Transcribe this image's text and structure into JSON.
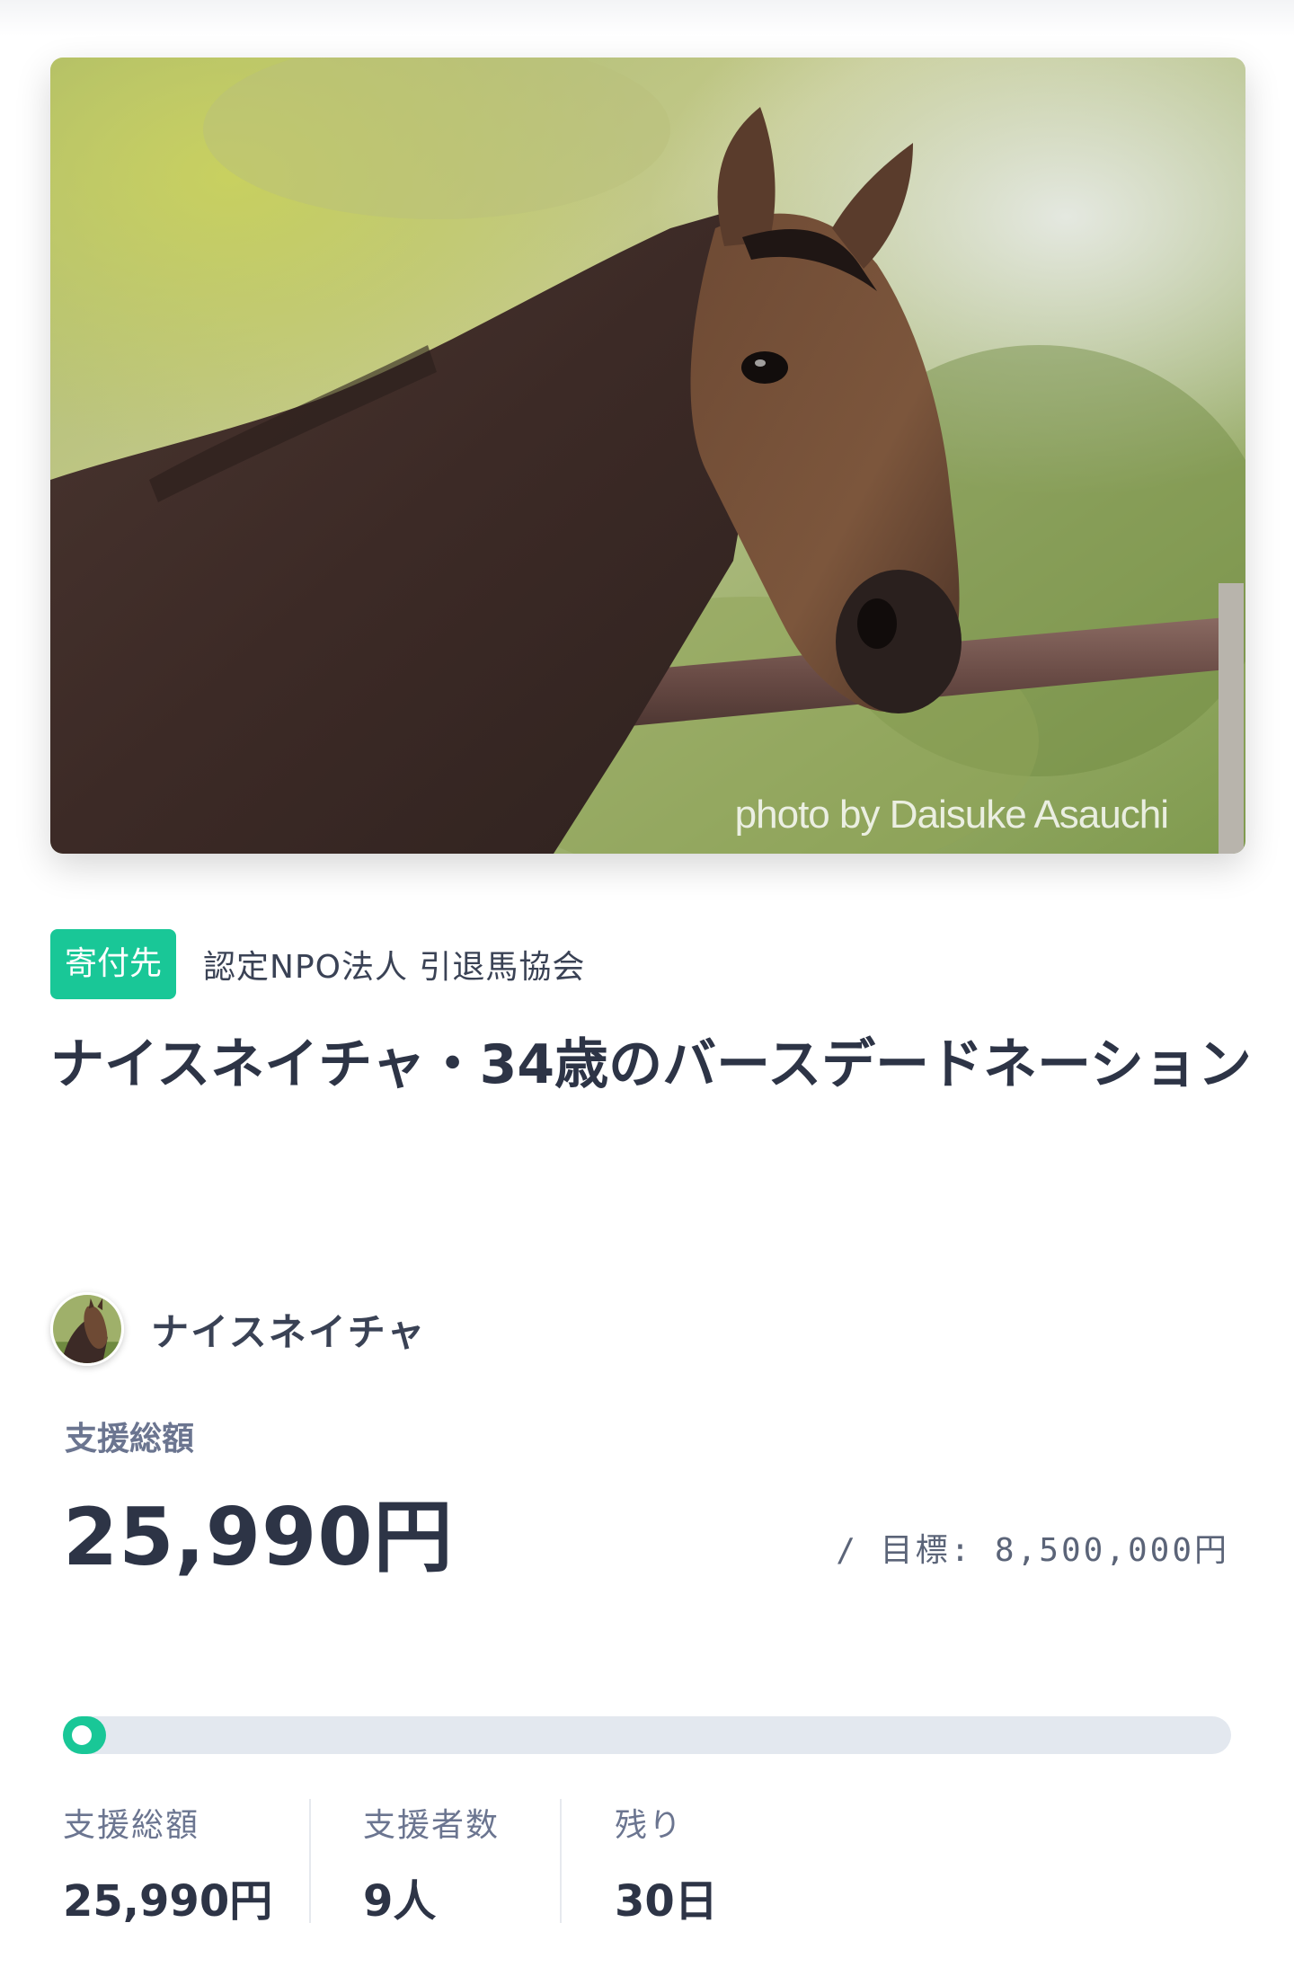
{
  "hero": {
    "credit": "photo by Daisuke Asauchi",
    "icon": "horse-photo"
  },
  "org": {
    "badge": "寄付先",
    "name": "認定NPO法人 引退馬協会"
  },
  "project": {
    "title": "ナイスネイチャ・34歳のバースデードネーション"
  },
  "owner": {
    "name": "ナイスネイチャ",
    "avatar_icon": "horse-avatar"
  },
  "funding": {
    "total_label": "支援総額",
    "total_amount": "25,990円",
    "goal": "/ 目標: 8,500,000円",
    "progress_percent": 0.3
  },
  "stats": [
    {
      "label": "支援総額",
      "value": "25,990円"
    },
    {
      "label": "支援者数",
      "value": "9人"
    },
    {
      "label": "残り",
      "value": "30日"
    }
  ],
  "colors": {
    "accent": "#19c797",
    "text": "#2d3446",
    "muted": "#6b7590",
    "track": "#e3e8ef"
  }
}
